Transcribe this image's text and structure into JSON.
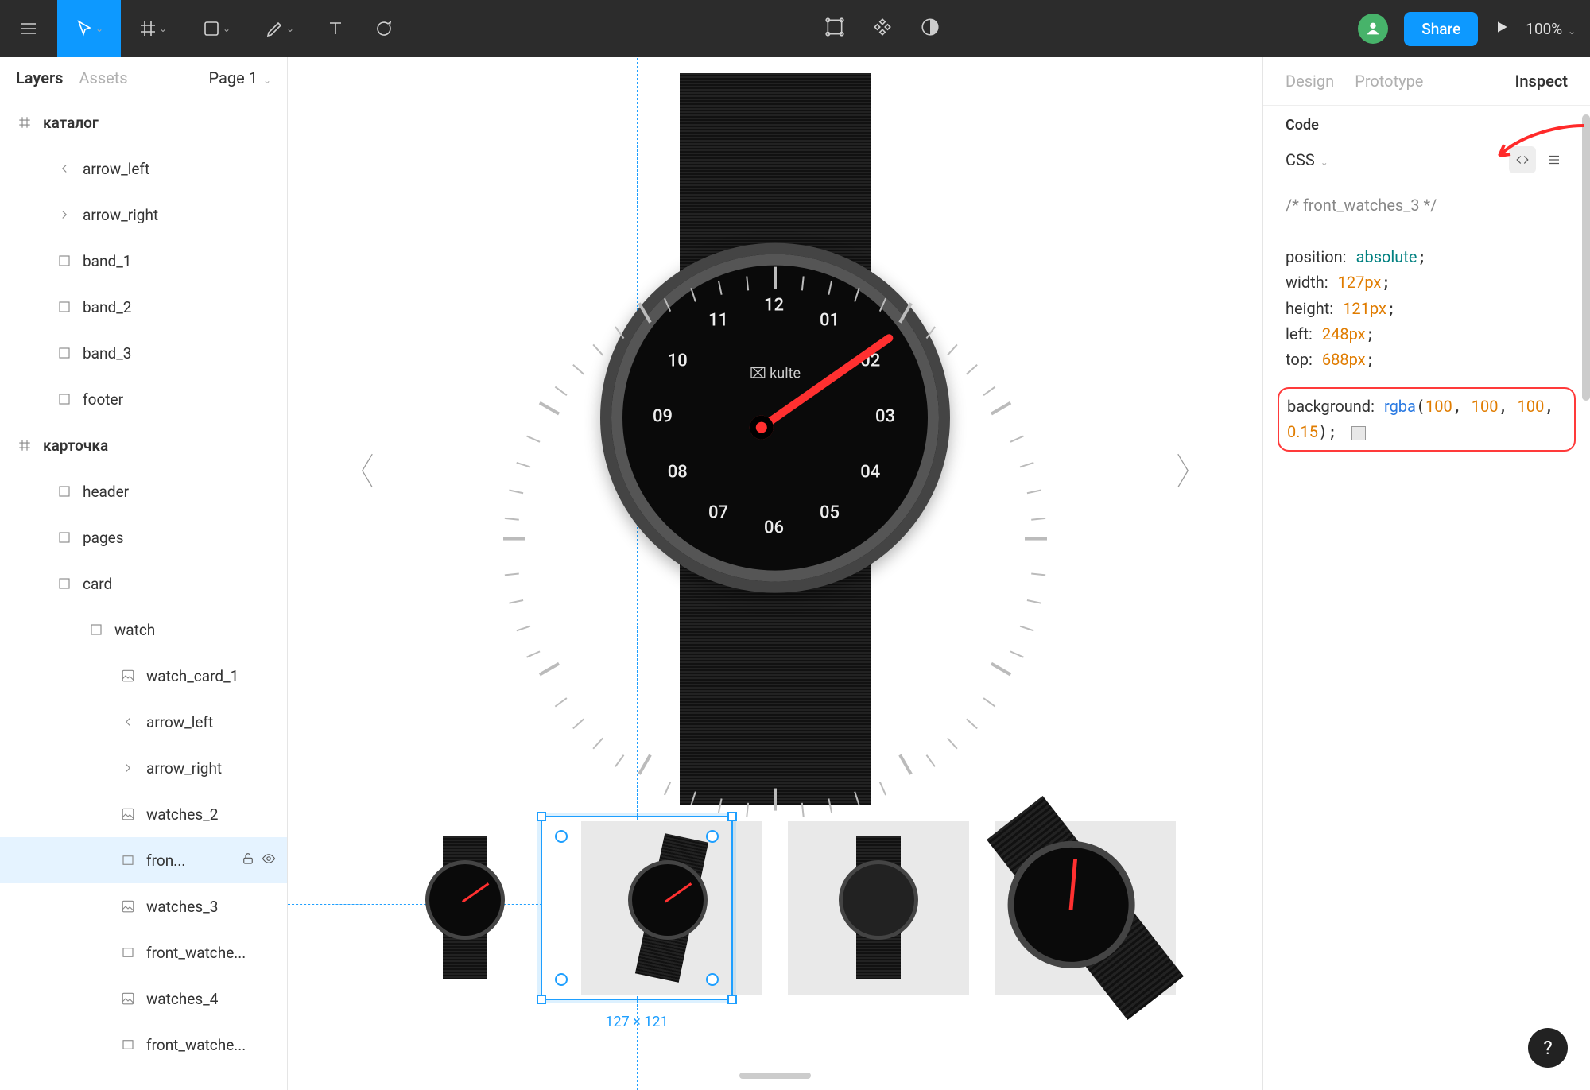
{
  "toolbar": {
    "share_label": "Share",
    "zoom_label": "100%"
  },
  "sidebar_left": {
    "tabs": {
      "layers": "Layers",
      "assets": "Assets"
    },
    "page_selector": "Page 1",
    "frames": {
      "catalog": "каталог",
      "card": "карточка"
    },
    "layers": {
      "arrow_left": "arrow_left",
      "arrow_right": "arrow_right",
      "band_1": "band_1",
      "band_2": "band_2",
      "band_3": "band_3",
      "footer": "footer",
      "header": "header",
      "pages": "pages",
      "card": "card",
      "watch": "watch",
      "watch_card_1": "watch_card_1",
      "arrow_left2": "arrow_left",
      "arrow_right2": "arrow_right",
      "watches_2": "watches_2",
      "front_selected": "fron...",
      "watches_3": "watches_3",
      "front_watches_trunc": "front_watche...",
      "watches_4": "watches_4",
      "front_watches_trunc2": "front_watche..."
    }
  },
  "canvas": {
    "watch_brand": "⌧ kulte",
    "numbers": [
      "12",
      "01",
      "02",
      "03",
      "04",
      "05",
      "06",
      "07",
      "08",
      "09",
      "10",
      "11"
    ],
    "selection_size_label": "127 × 121"
  },
  "sidebar_right": {
    "tabs": {
      "design": "Design",
      "prototype": "Prototype",
      "inspect": "Inspect"
    },
    "code_section_title": "Code",
    "code_lang": "CSS",
    "css": {
      "comment": "/* front_watches_3 */",
      "position_k": "position:",
      "position_v": "absolute",
      "width_k": "width:",
      "width_v": "127px",
      "height_k": "height:",
      "height_v": "121px",
      "left_k": "left:",
      "left_v": "248px",
      "top_k": "top:",
      "top_v": "688px",
      "bg_k": "background:",
      "bg_func": "rgba",
      "bg_r": "100",
      "bg_g": "100",
      "bg_b": "100",
      "bg_a": "0.15"
    }
  },
  "help_label": "?"
}
